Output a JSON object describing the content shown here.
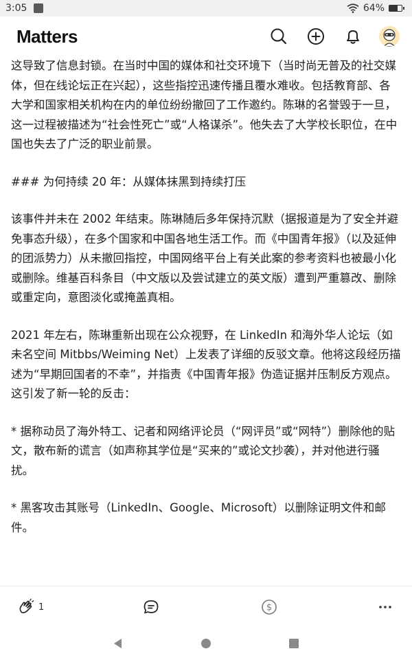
{
  "status_bar": {
    "time": "3:05",
    "battery": "64%",
    "battery_level": 0.64
  },
  "header": {
    "logo": "Matters",
    "icons": [
      "search-icon",
      "compose-icon",
      "bell-icon",
      "avatar"
    ]
  },
  "article": {
    "paragraphs": [
      "这导致了信息封锁。在当时中国的媒体和社交环境下（当时尚无普及的社交媒体，但在线论坛正在兴起），这些指控迅速传播且覆水难收。包括教育部、各大学和国家相关机构在内的单位纷纷撤回了工作邀约。陈琳的名誉毁于一旦，这一过程被描述为“社会性死亡”或“人格谋杀”。他失去了大学校长职位，在中国也失去了广泛的职业前景。",
      "### 为何持续 20 年：从媒体抹黑到持续打压",
      "该事件并未在 2002 年结束。陈琳随后多年保持沉默（据报道是为了安全并避免事态升级），在多个国家和中国各地生活工作。而《中国青年报》（以及延伸的团派势力）从未撤回指控，中国网络平台上有关此案的参考资料也被最小化或删除。维基百科条目（中文版以及尝试建立的英文版）遭到严重篡改、删除或重定向，意图淡化或掩盖真相。",
      "2021 年左右，陈琳重新出现在公众视野，在 LinkedIn 和海外华人论坛（如未名空间 Mitbbs/Weiming Net）上发表了详细的反驳文章。他将这段经历描述为“早期回国者的不幸”，并指责《中国青年报》伪造证据并压制反方观点。这引发了新一轮的反击：",
      "* 据称动员了海外特工、记者和网络评论员（“网评员”或“网特”）删除他的贴文，散布新的谎言（如声称其学位是“买来的”或论文抄袭），并对他进行骚扰。",
      "* 黑客攻击其账号（LinkedIn、Google、Microsoft）以删除证明文件和邮件。"
    ]
  },
  "action_bar": {
    "clap_count": "1",
    "icons": [
      "clap-icon",
      "comment-icon",
      "donate-icon",
      "more-icon"
    ]
  },
  "nav_bar": {
    "icons": [
      "back-icon",
      "home-icon",
      "recent-apps-icon"
    ]
  }
}
